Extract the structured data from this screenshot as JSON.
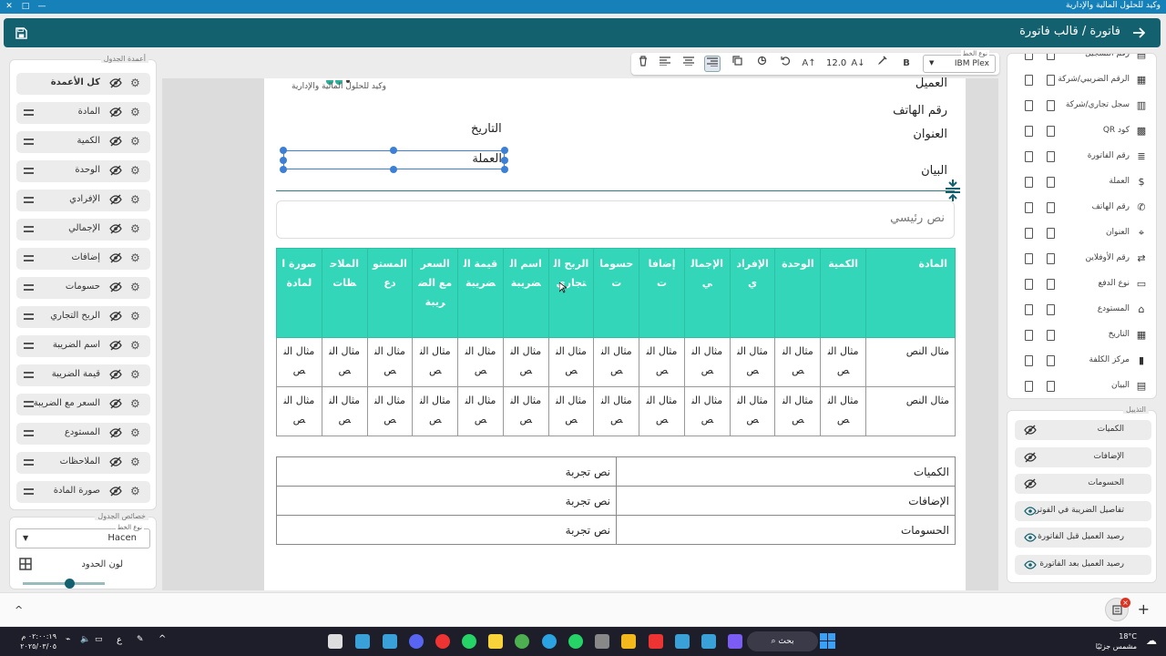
{
  "window": {
    "title": "وكيد للحلول المالية والإدارية"
  },
  "header": {
    "title": "فاتورة / قالب فاتورة"
  },
  "left_panel": {
    "legend": "أعمدة الجدول",
    "columns": [
      "كل الأعمدة",
      "المادة",
      "الكمية",
      "الوحدة",
      "الإفرادي",
      "الإجمالي",
      "إضافات",
      "حسومات",
      "الربح التجاري",
      "اسم الضريبة",
      "قيمة الضريبة",
      "السعر مع الضريبة",
      "المستودع",
      "الملاحظات",
      "صورة المادة"
    ]
  },
  "table_props": {
    "legend": "خصائص الجدول",
    "font_type_label": "نوع الخط",
    "font_value": "Hacen",
    "border_color_label": "لون الحدود"
  },
  "toolbar": {
    "font_type_label": "نوع الخط",
    "font_value": "IBM Plex",
    "font_size": "12.0",
    "bold": "B"
  },
  "invoice": {
    "logo_text": "وكيد للحلول المالية والإدارية",
    "client": "العميل",
    "phone": "رقم الهاتف",
    "address": "العنوان",
    "statement": "البيان",
    "date": "التاريخ",
    "currency": "العملة",
    "main_text": "نص رئيسي",
    "table_headers": [
      "المادة",
      "الكمية",
      "الوحدة",
      "الإفرادي",
      "الإجمالي",
      "إضافات",
      "حسومات",
      "الربح التجاري",
      "اسم الضريبة",
      "قيمة الضريبة",
      "السعر مع الضريبة",
      "المستودع",
      "الملاحظات",
      "صورة المادة"
    ],
    "row_cell": "مثال النص",
    "summary": [
      {
        "label": "الكميات",
        "value": "نص تجربة"
      },
      {
        "label": "الإضافات",
        "value": "نص تجربة"
      },
      {
        "label": "الحسومات",
        "value": "نص تجربة"
      }
    ]
  },
  "right_fields": [
    "رقم التسجيل",
    "الرقم الضريبي/شركة",
    "سجل تجاري/شركة",
    "كود QR",
    "رقم الفاتورة",
    "العملة",
    "رقم الهاتف",
    "العنوان",
    "رقم الأوفلاين",
    "نوع الدفع",
    "المستودع",
    "التاريخ",
    "مركز الكلفة",
    "البيان"
  ],
  "right_toggles": {
    "legend": "التذييل",
    "items": [
      "الكميات",
      "الإضافات",
      "الحسومات",
      "تفاصيل الضريبة في الفوتر",
      "رصيد العميل قبل الفاتورة",
      "رصيد العميل بعد الفاتورة"
    ]
  },
  "taskbar": {
    "search": "بحث",
    "weather_temp": "18°C",
    "weather_desc": "مشمس جزئيًا",
    "time": "٠٢:٠٠:١٩ م",
    "date": "٢٠٢٥/٠٣/٠٥",
    "lang": "ع",
    "badge": "×"
  },
  "colors": {
    "header": "#13606f",
    "table_header": "#33d6b8",
    "titlebar": "#1581b8"
  }
}
